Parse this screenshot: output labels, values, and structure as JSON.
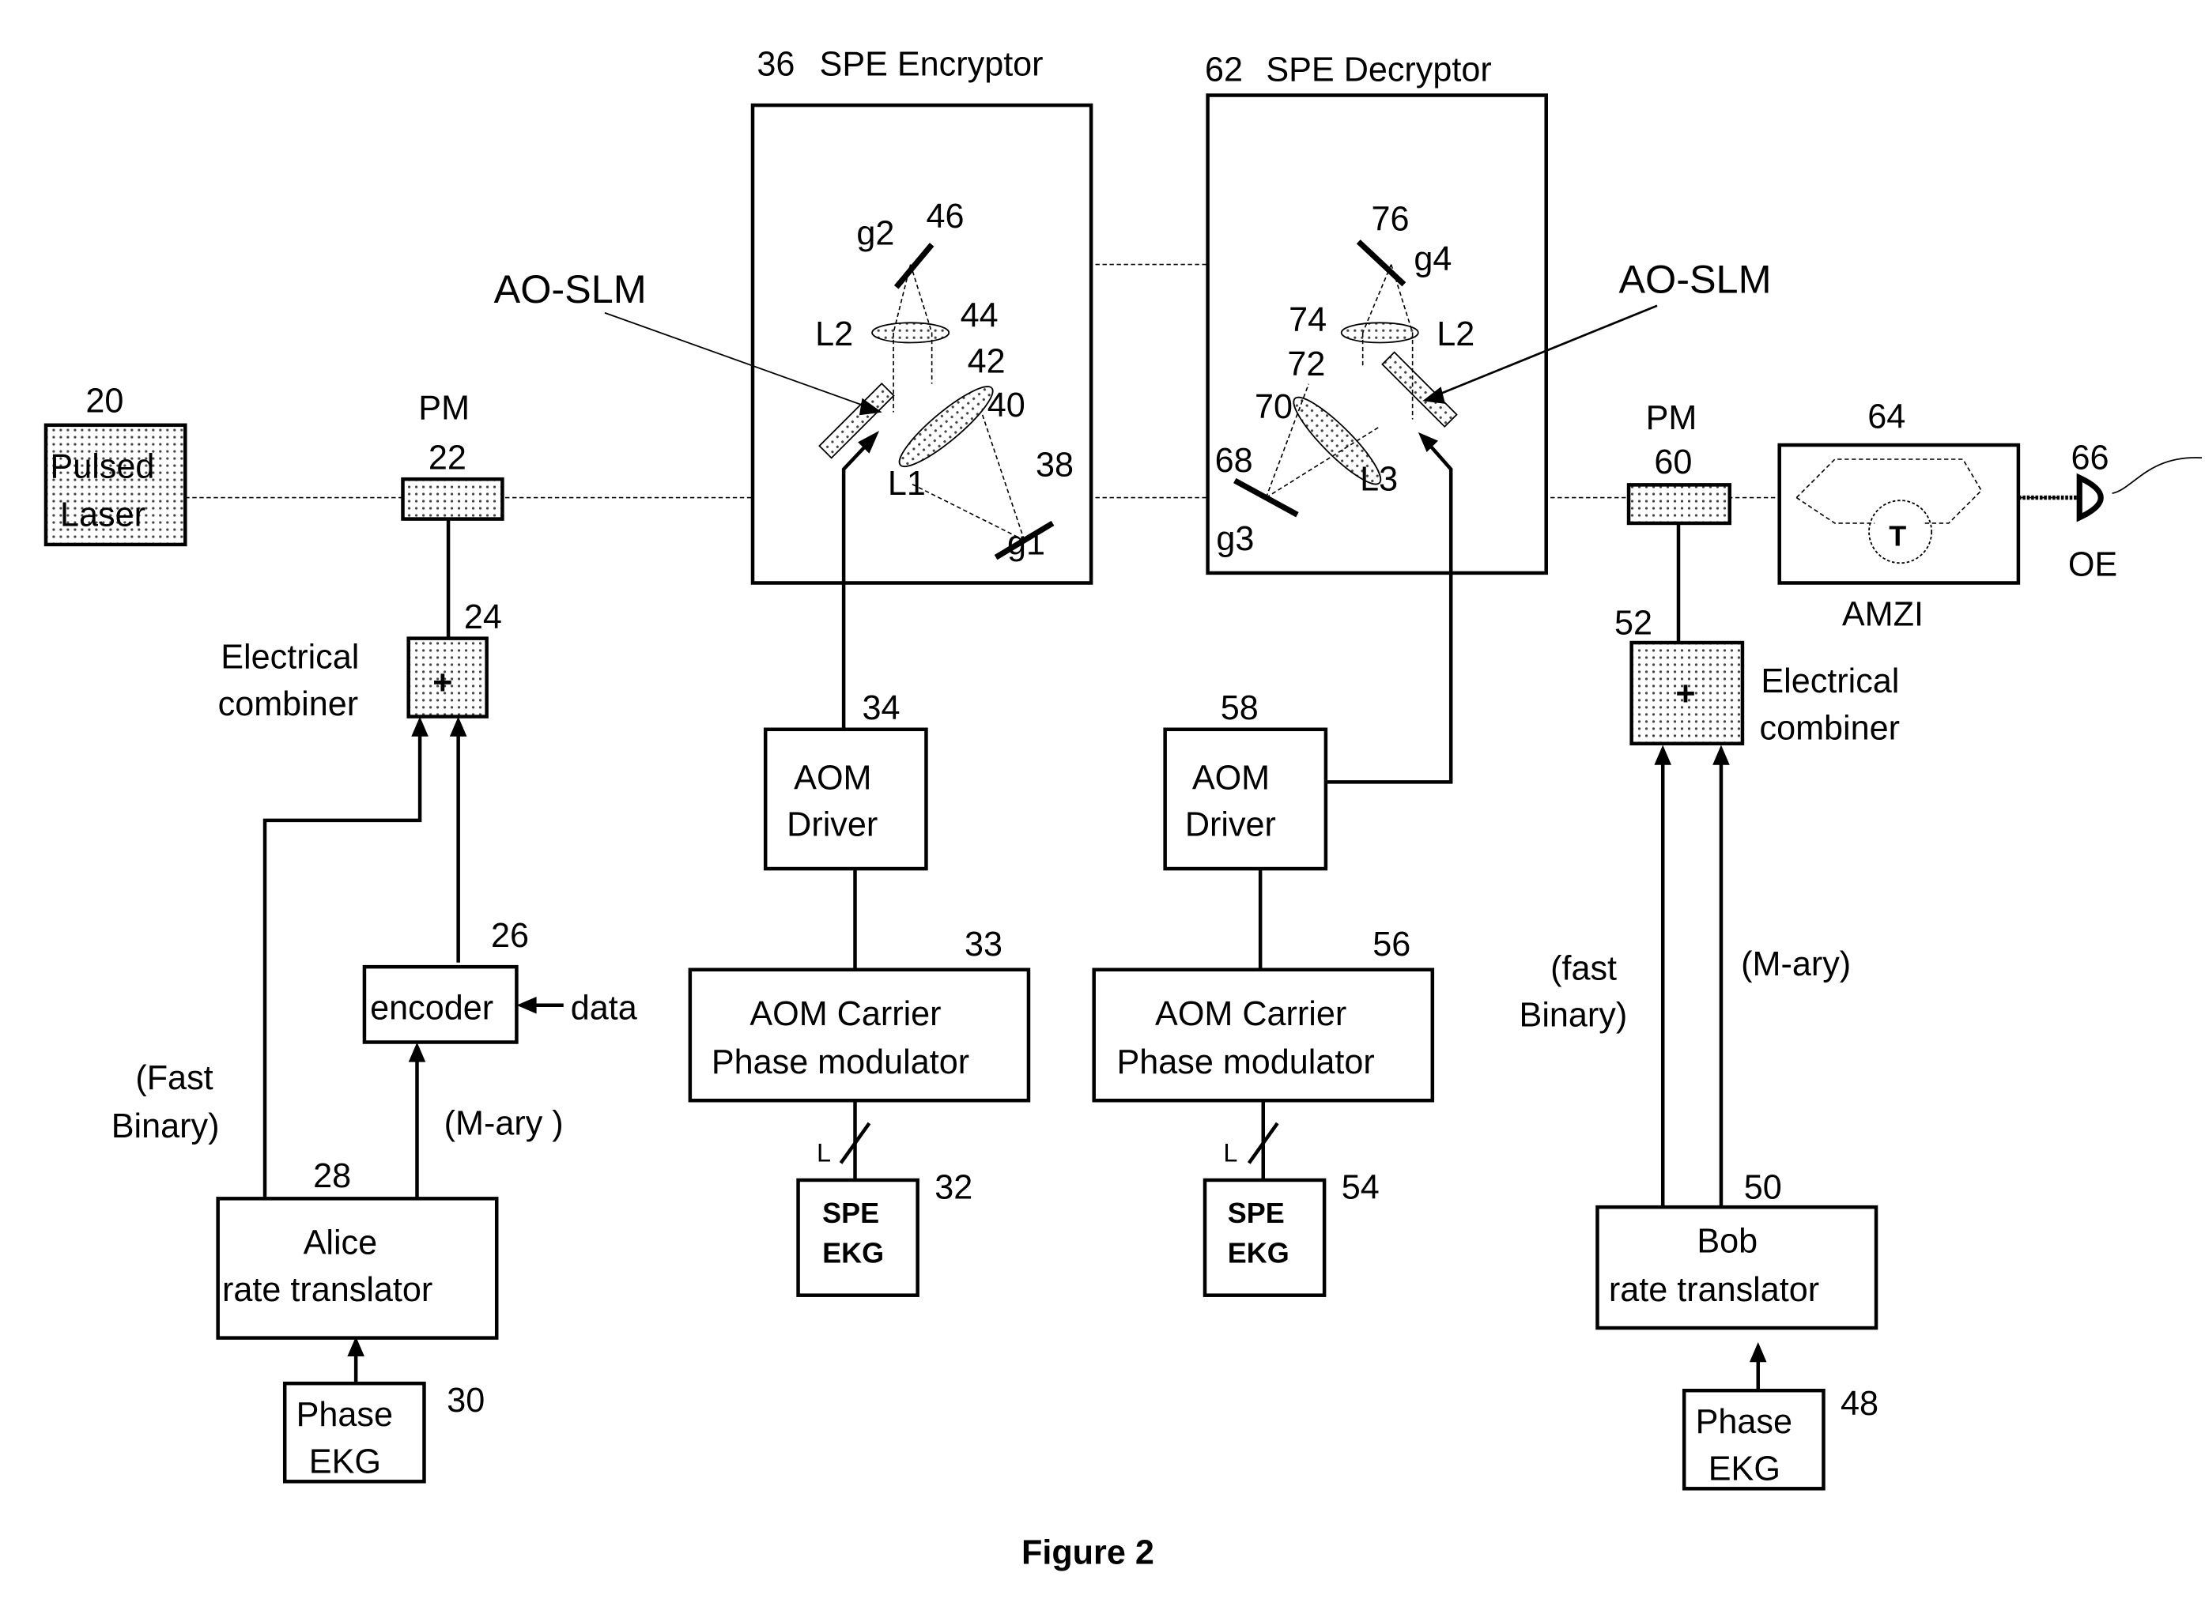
{
  "figure_title": "Figure 2",
  "pulsed_laser": {
    "num": "20",
    "line1": "Pulsed",
    "line2": "Laser"
  },
  "pm_alice": {
    "label": "PM",
    "num": "22"
  },
  "combiner_alice": {
    "num": "24",
    "line1": "Electrical",
    "line2": "combiner",
    "symbol": "+"
  },
  "encoder": {
    "num": "26",
    "label": "encoder",
    "input": "data"
  },
  "alice_translator": {
    "num": "28",
    "line1": "Alice",
    "line2": "rate translator"
  },
  "alice_phase_ekg": {
    "num": "30",
    "line1": "Phase",
    "line2": "EKG"
  },
  "alice_fast": {
    "line1": "(Fast",
    "line2": "Binary)"
  },
  "alice_mary": "(M-ary )",
  "encryptor": {
    "num": "36",
    "title": "SPE Encryptor",
    "g1": "g1",
    "n38": "38",
    "L1": "L1",
    "n40": "40",
    "n42": "42",
    "L2": "L2",
    "n44": "44",
    "g2": "g2",
    "n46": "46"
  },
  "ao_slm_left": "AO-SLM",
  "aom_driver_left": {
    "num": "34",
    "line1": "AOM",
    "line2": "Driver"
  },
  "aom_carrier_left": {
    "num": "33",
    "line1": "AOM Carrier",
    "line2": "Phase modulator"
  },
  "spe_ekg_left": {
    "num": "32",
    "line1": "SPE",
    "line2": "EKG",
    "bus": "L"
  },
  "decryptor": {
    "num": "62",
    "title": "SPE Decryptor",
    "g3": "g3",
    "n68": "68",
    "L3": "L3",
    "n70": "70",
    "n72": "72",
    "L2": "L2",
    "n74": "74",
    "g4": "g4",
    "n76": "76"
  },
  "ao_slm_right": "AO-SLM",
  "aom_driver_right": {
    "num": "58",
    "line1": "AOM",
    "line2": "Driver"
  },
  "aom_carrier_right": {
    "num": "56",
    "line1": "AOM Carrier",
    "line2": "Phase modulator"
  },
  "spe_ekg_right": {
    "num": "54",
    "line1": "SPE",
    "line2": "EKG",
    "bus": "L"
  },
  "pm_bob": {
    "label": "PM",
    "num": "60"
  },
  "amzi": {
    "num": "64",
    "label": "AMZI",
    "symbol": "T"
  },
  "oe": {
    "num": "66",
    "label": "OE"
  },
  "combiner_bob": {
    "num": "52",
    "line1": "Electrical",
    "line2": "combiner",
    "symbol": "+"
  },
  "bob_fast": {
    "line1": "(fast",
    "line2": "Binary)"
  },
  "bob_mary": "(M-ary)",
  "bob_translator": {
    "num": "50",
    "line1": "Bob",
    "line2": "rate translator"
  },
  "bob_phase_ekg": {
    "num": "48",
    "line1": "Phase",
    "line2": "EKG"
  }
}
